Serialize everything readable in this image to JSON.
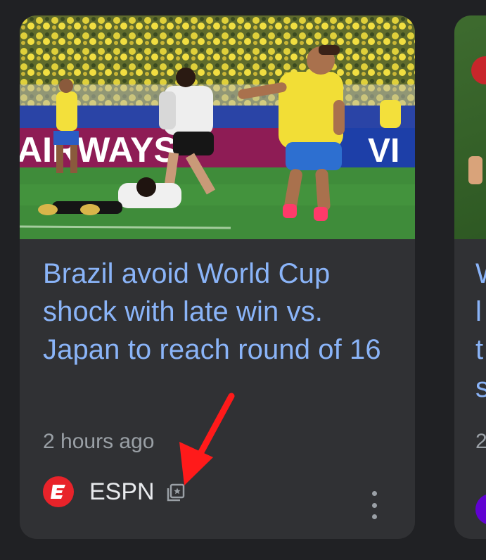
{
  "cards": [
    {
      "headline": "Brazil avoid World Cup shock with late win vs. Japan to reach round of 16",
      "timestamp": "2 hours ago",
      "source": {
        "name": "ESPN",
        "logo_icon": "espn-logo-icon",
        "logo_color": "#e8232a",
        "badge_icon": "news-publisher-icon"
      },
      "image": {
        "banner_text": "AIRWAYS",
        "banner_text_right": "VI"
      }
    },
    {
      "headline_lines": [
        "W",
        "l",
        "t",
        "s"
      ],
      "timestamp": "2",
      "source": {
        "logo_color": "#6001d2"
      }
    }
  ],
  "colors": {
    "background": "#202124",
    "card": "#303134",
    "headline": "#8ab4f8",
    "muted": "#9aa0a6",
    "source": "#e8eaed",
    "annotation_arrow": "#ff1a1a"
  }
}
